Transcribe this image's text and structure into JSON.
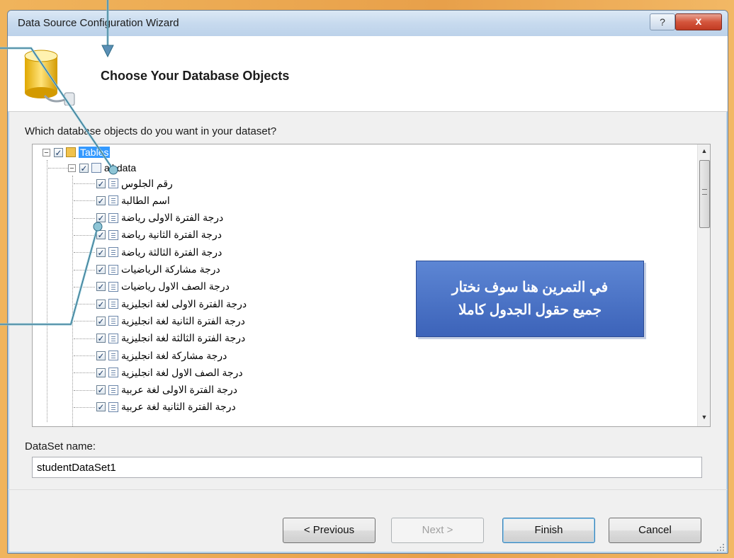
{
  "window": {
    "title": "Data Source Configuration Wizard",
    "help_label": "?",
    "close_label": "x"
  },
  "header": {
    "title": "Choose Your Database Objects"
  },
  "question": "Which database objects do you want in your dataset?",
  "tree": {
    "root_label": "Tables",
    "table_label": "all data",
    "fields": [
      "رقم الجلوس",
      "اسم الطالبة",
      "درجة الفترة الاولى رياضة",
      "درجة الفترة الثانية رياضة",
      "درجة الفترة الثالثة رياضة",
      "درجة مشاركة الرياضيات",
      "درجة الصف الاول رياضيات",
      "درجة الفترة الاولى لغة انجليزية",
      "درجة الفترة الثانية لغة انجليزية",
      "درجة الفترة الثالثة لغة انجليزية",
      "درجة مشاركة لغة انجليزية",
      "درجة الصف الاول لغة انجليزية",
      "درجة الفترة الاولى لغة عربية",
      "درجة الفترة الثانية لغة عربية"
    ],
    "checked_mark": "✓"
  },
  "callout": {
    "line1": "في التمرين هنا سوف نختار",
    "line2": "جميع حقول الجدول كاملا"
  },
  "dataset": {
    "label": "DataSet name:",
    "value": "studentDataSet1"
  },
  "buttons": {
    "previous": "< Previous",
    "next": "Next >",
    "finish": "Finish",
    "cancel": "Cancel"
  },
  "colors": {
    "accent": "#3399ff",
    "callout_bg": "#3c63b9",
    "annotation_line": "#8ec5d6",
    "desktop": "#e9a44a"
  }
}
